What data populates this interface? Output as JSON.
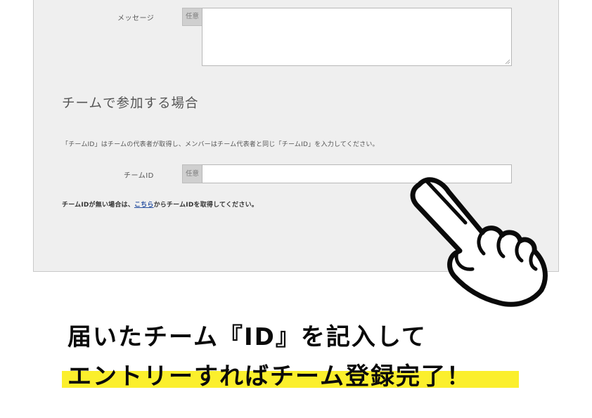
{
  "form": {
    "message_label": "メッセージ",
    "optional_tag": "任意",
    "team_section_heading": "チームで参加する場合",
    "team_section_note": "「チームID」はチームの代表者が取得し、メンバーはチーム代表者と同じ「チームID」を入力してください。",
    "team_id_label": "チームID",
    "help_before_link": "チームIDが無い場合は、",
    "help_link": "こちら",
    "help_after_link": "からチームIDを取得してください。"
  },
  "caption": {
    "line1": "届いたチーム『ID』を記入して",
    "line2": "エントリーすればチーム登録完了！",
    "highlight_color": "#fbef2c"
  },
  "icons": {
    "pointer": "pointing-hand-icon"
  }
}
